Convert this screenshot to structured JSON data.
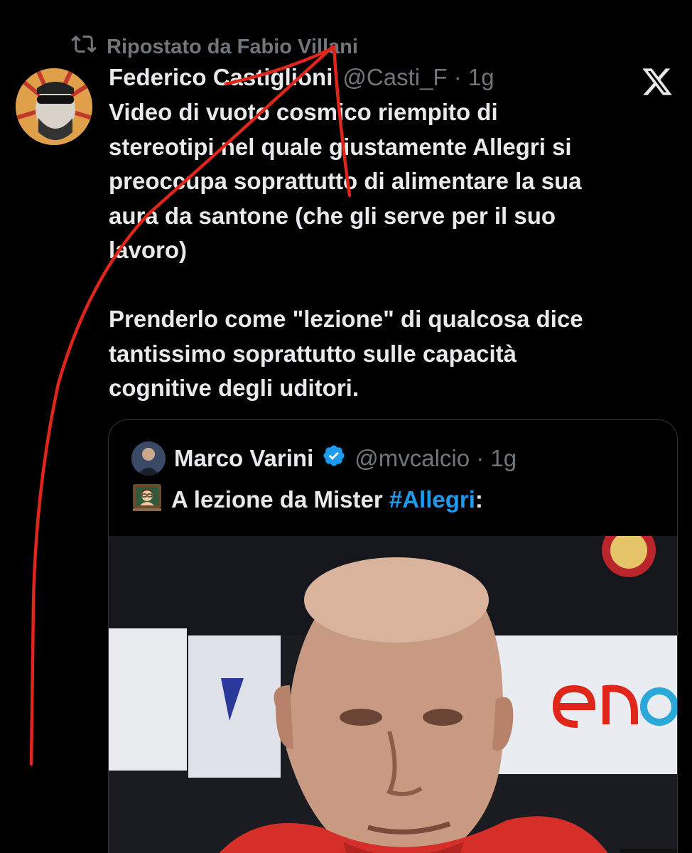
{
  "repost": {
    "text": "Ripostato da Fabio Villani",
    "icon": "repost-icon"
  },
  "tweet": {
    "display_name": "Federico Castiglioni",
    "handle_time": "@Casti_F · 1g",
    "text": "Video di vuoto cosmico riempito di\nstereotipi nel quale giustamente Allegri si\npreoccupa soprattutto di alimentare la sua\naura da santone (che gli serve per il suo\nlavoro)\n\nPrenderlo come \"lezione\" di qualcosa dice\ntantissimo soprattutto sulle capacità\ncognitive degli uditori."
  },
  "quoted_tweet": {
    "display_name": "Marco Varini",
    "handle_time": "@mvcalcio · 1g",
    "text_prefix": "A lezione da Mister ",
    "hashtag": "#Allegri",
    "text_suffix": ":"
  },
  "colors": {
    "background": "#000000",
    "text": "#e7e9ea",
    "muted": "#71767b",
    "link": "#1d9bf0",
    "annotation": "#e0261b"
  }
}
